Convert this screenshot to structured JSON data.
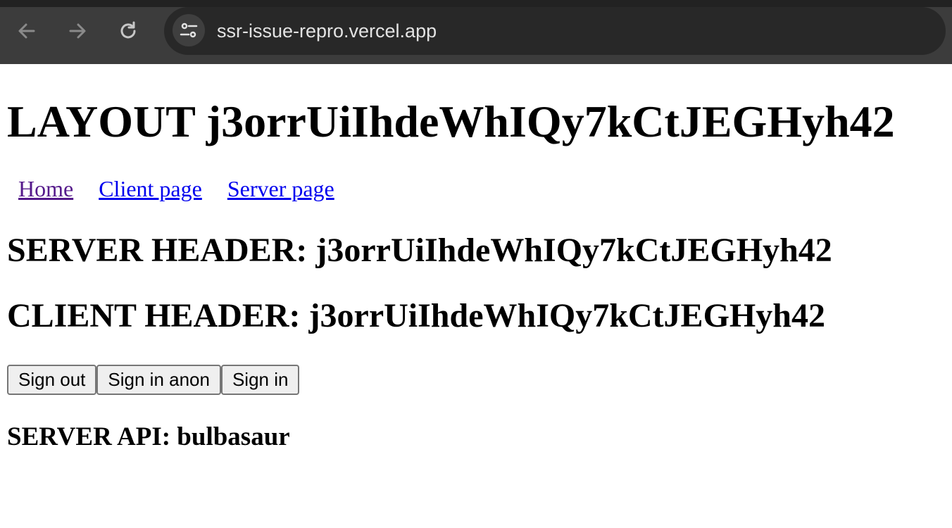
{
  "browser": {
    "url": "ssr-issue-repro.vercel.app",
    "icons": {
      "back": "arrow-left-icon",
      "forward": "arrow-right-icon",
      "reload": "reload-icon",
      "site_info": "tune-icon"
    },
    "colors": {
      "toolbar": "#3c3c3c",
      "omnibox": "#282828",
      "url_text": "#e3e3e3"
    }
  },
  "page": {
    "layout_title": "LAYOUT j3orrUiIhdeWhIQy7kCtJEGHyh42",
    "nav_links": [
      {
        "label": "Home",
        "visited": true
      },
      {
        "label": "Client page",
        "visited": false
      },
      {
        "label": "Server page",
        "visited": false
      }
    ],
    "server_header": "SERVER HEADER: j3orrUiIhdeWhIQy7kCtJEGHyh42",
    "client_header": "CLIENT HEADER: j3orrUiIhdeWhIQy7kCtJEGHyh42",
    "buttons": {
      "sign_out": "Sign out",
      "sign_in_anon": "Sign in anon",
      "sign_in": "Sign in"
    },
    "server_api": "SERVER API: bulbasaur",
    "colors": {
      "link": "#0000ee",
      "visited_link": "#551a8b"
    }
  }
}
